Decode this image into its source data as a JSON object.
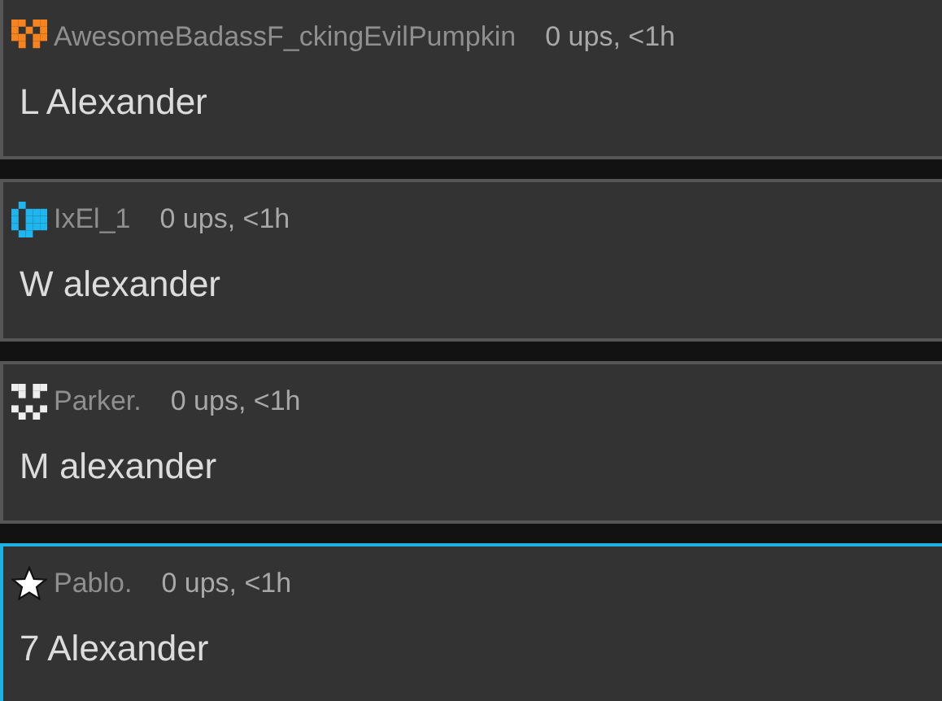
{
  "comments": [
    {
      "avatar": {
        "kind": "identicon",
        "color": "#f7831e"
      },
      "username": "AwesomeBadassF_ckingEvilPumpkin",
      "meta": "0 ups, <1h",
      "text": "L Alexander",
      "highlighted": false
    },
    {
      "avatar": {
        "kind": "identicon",
        "color": "#1fb6f0"
      },
      "username": "IxEl_1",
      "meta": "0 ups, <1h",
      "text": "W alexander",
      "highlighted": false
    },
    {
      "avatar": {
        "kind": "identicon",
        "color": "#eeeeee"
      },
      "username": "Parker.",
      "meta": "0 ups, <1h",
      "text": "M alexander",
      "highlighted": false
    },
    {
      "avatar": {
        "kind": "star"
      },
      "username": "Pablo.",
      "meta": "0 ups, <1h",
      "text": "7 Alexander",
      "highlighted": true
    }
  ]
}
